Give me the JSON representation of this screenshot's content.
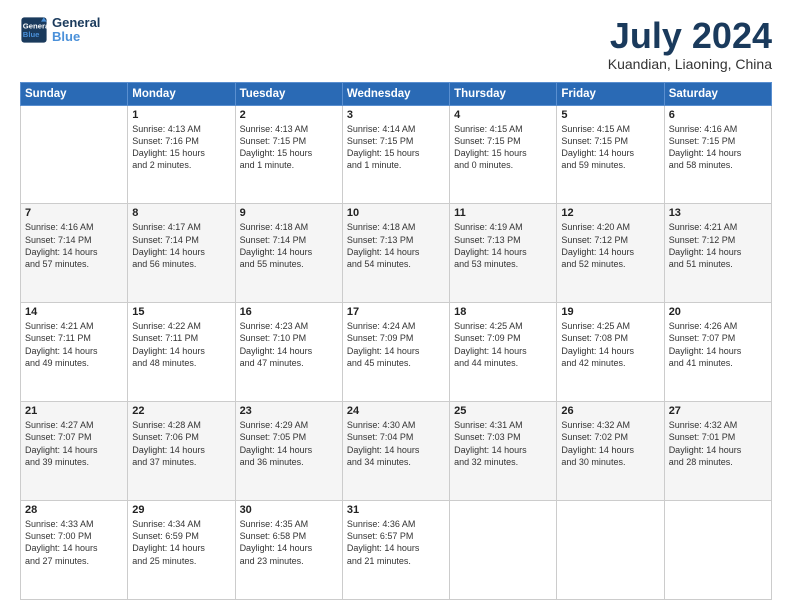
{
  "logo": {
    "line1": "General",
    "line2": "Blue"
  },
  "title": "July 2024",
  "location": "Kuandian, Liaoning, China",
  "weekdays": [
    "Sunday",
    "Monday",
    "Tuesday",
    "Wednesday",
    "Thursday",
    "Friday",
    "Saturday"
  ],
  "weeks": [
    [
      {
        "day": "",
        "info": ""
      },
      {
        "day": "1",
        "info": "Sunrise: 4:13 AM\nSunset: 7:16 PM\nDaylight: 15 hours\nand 2 minutes."
      },
      {
        "day": "2",
        "info": "Sunrise: 4:13 AM\nSunset: 7:15 PM\nDaylight: 15 hours\nand 1 minute."
      },
      {
        "day": "3",
        "info": "Sunrise: 4:14 AM\nSunset: 7:15 PM\nDaylight: 15 hours\nand 1 minute."
      },
      {
        "day": "4",
        "info": "Sunrise: 4:15 AM\nSunset: 7:15 PM\nDaylight: 15 hours\nand 0 minutes."
      },
      {
        "day": "5",
        "info": "Sunrise: 4:15 AM\nSunset: 7:15 PM\nDaylight: 14 hours\nand 59 minutes."
      },
      {
        "day": "6",
        "info": "Sunrise: 4:16 AM\nSunset: 7:15 PM\nDaylight: 14 hours\nand 58 minutes."
      }
    ],
    [
      {
        "day": "7",
        "info": "Sunrise: 4:16 AM\nSunset: 7:14 PM\nDaylight: 14 hours\nand 57 minutes."
      },
      {
        "day": "8",
        "info": "Sunrise: 4:17 AM\nSunset: 7:14 PM\nDaylight: 14 hours\nand 56 minutes."
      },
      {
        "day": "9",
        "info": "Sunrise: 4:18 AM\nSunset: 7:14 PM\nDaylight: 14 hours\nand 55 minutes."
      },
      {
        "day": "10",
        "info": "Sunrise: 4:18 AM\nSunset: 7:13 PM\nDaylight: 14 hours\nand 54 minutes."
      },
      {
        "day": "11",
        "info": "Sunrise: 4:19 AM\nSunset: 7:13 PM\nDaylight: 14 hours\nand 53 minutes."
      },
      {
        "day": "12",
        "info": "Sunrise: 4:20 AM\nSunset: 7:12 PM\nDaylight: 14 hours\nand 52 minutes."
      },
      {
        "day": "13",
        "info": "Sunrise: 4:21 AM\nSunset: 7:12 PM\nDaylight: 14 hours\nand 51 minutes."
      }
    ],
    [
      {
        "day": "14",
        "info": "Sunrise: 4:21 AM\nSunset: 7:11 PM\nDaylight: 14 hours\nand 49 minutes."
      },
      {
        "day": "15",
        "info": "Sunrise: 4:22 AM\nSunset: 7:11 PM\nDaylight: 14 hours\nand 48 minutes."
      },
      {
        "day": "16",
        "info": "Sunrise: 4:23 AM\nSunset: 7:10 PM\nDaylight: 14 hours\nand 47 minutes."
      },
      {
        "day": "17",
        "info": "Sunrise: 4:24 AM\nSunset: 7:09 PM\nDaylight: 14 hours\nand 45 minutes."
      },
      {
        "day": "18",
        "info": "Sunrise: 4:25 AM\nSunset: 7:09 PM\nDaylight: 14 hours\nand 44 minutes."
      },
      {
        "day": "19",
        "info": "Sunrise: 4:25 AM\nSunset: 7:08 PM\nDaylight: 14 hours\nand 42 minutes."
      },
      {
        "day": "20",
        "info": "Sunrise: 4:26 AM\nSunset: 7:07 PM\nDaylight: 14 hours\nand 41 minutes."
      }
    ],
    [
      {
        "day": "21",
        "info": "Sunrise: 4:27 AM\nSunset: 7:07 PM\nDaylight: 14 hours\nand 39 minutes."
      },
      {
        "day": "22",
        "info": "Sunrise: 4:28 AM\nSunset: 7:06 PM\nDaylight: 14 hours\nand 37 minutes."
      },
      {
        "day": "23",
        "info": "Sunrise: 4:29 AM\nSunset: 7:05 PM\nDaylight: 14 hours\nand 36 minutes."
      },
      {
        "day": "24",
        "info": "Sunrise: 4:30 AM\nSunset: 7:04 PM\nDaylight: 14 hours\nand 34 minutes."
      },
      {
        "day": "25",
        "info": "Sunrise: 4:31 AM\nSunset: 7:03 PM\nDaylight: 14 hours\nand 32 minutes."
      },
      {
        "day": "26",
        "info": "Sunrise: 4:32 AM\nSunset: 7:02 PM\nDaylight: 14 hours\nand 30 minutes."
      },
      {
        "day": "27",
        "info": "Sunrise: 4:32 AM\nSunset: 7:01 PM\nDaylight: 14 hours\nand 28 minutes."
      }
    ],
    [
      {
        "day": "28",
        "info": "Sunrise: 4:33 AM\nSunset: 7:00 PM\nDaylight: 14 hours\nand 27 minutes."
      },
      {
        "day": "29",
        "info": "Sunrise: 4:34 AM\nSunset: 6:59 PM\nDaylight: 14 hours\nand 25 minutes."
      },
      {
        "day": "30",
        "info": "Sunrise: 4:35 AM\nSunset: 6:58 PM\nDaylight: 14 hours\nand 23 minutes."
      },
      {
        "day": "31",
        "info": "Sunrise: 4:36 AM\nSunset: 6:57 PM\nDaylight: 14 hours\nand 21 minutes."
      },
      {
        "day": "",
        "info": ""
      },
      {
        "day": "",
        "info": ""
      },
      {
        "day": "",
        "info": ""
      }
    ]
  ]
}
